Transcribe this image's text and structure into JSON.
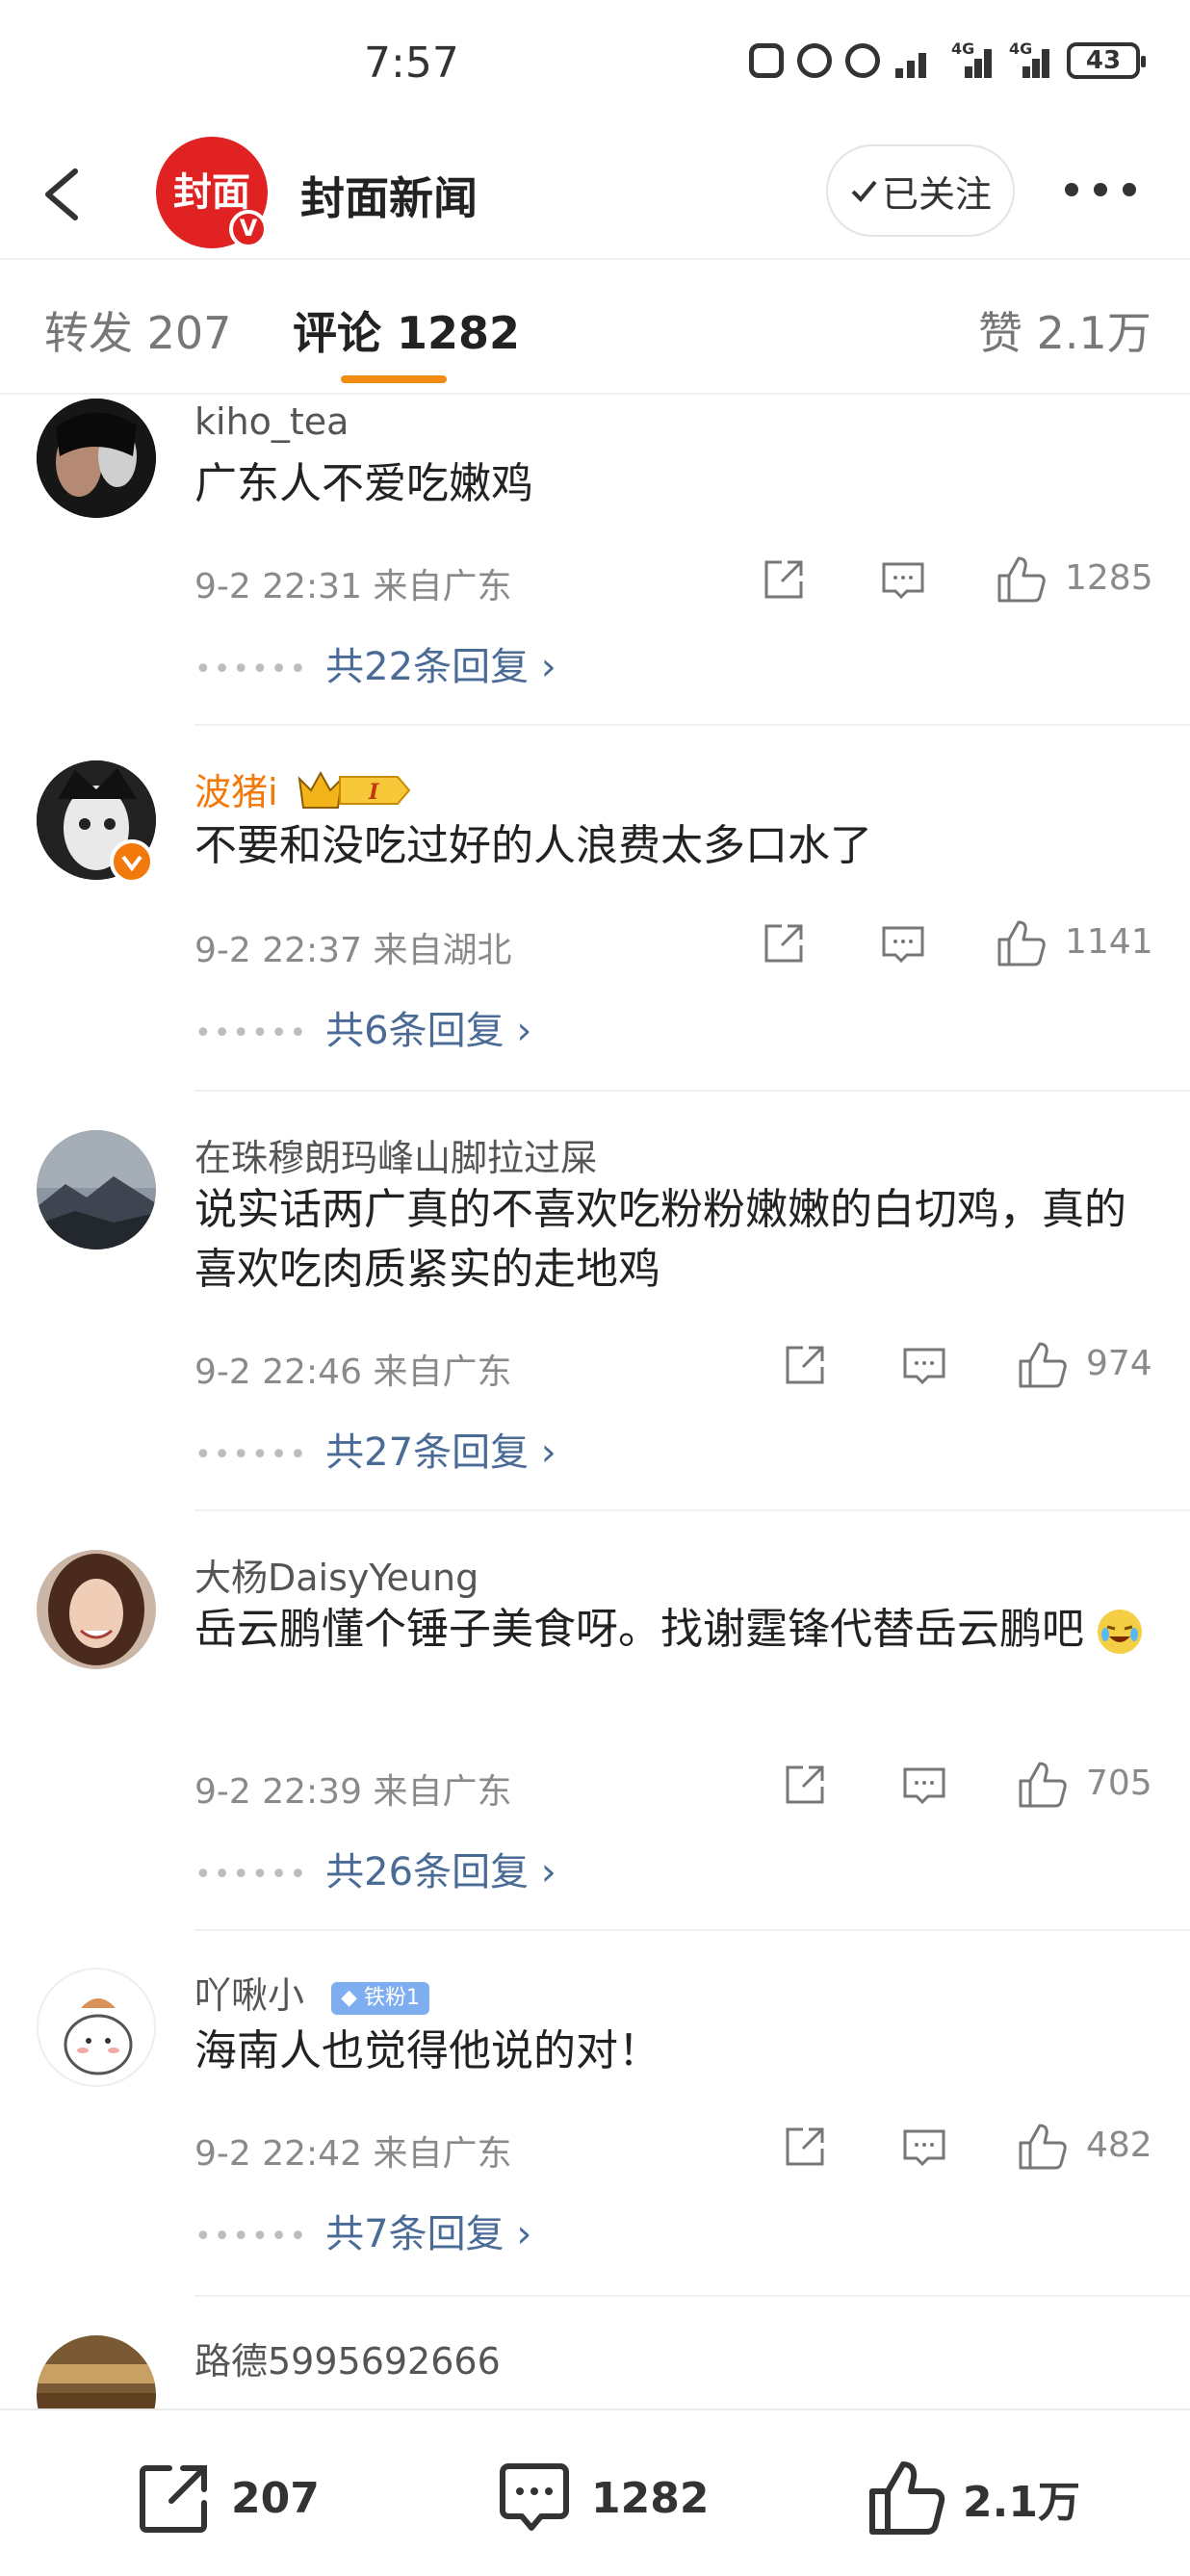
{
  "status_bar": {
    "time": "7:57",
    "battery": "43",
    "network_labels": [
      "4G",
      "4G"
    ]
  },
  "header": {
    "account_name": "封面新闻",
    "logo_text": "封面",
    "verified_badge": "V",
    "follow_label": "已关注"
  },
  "tabs": {
    "repost": "转发 207",
    "comments": "评论 1282",
    "likes": "赞 2.1万"
  },
  "comments": [
    {
      "user": "kiho_tea",
      "text": "广东人不爱吃嫩鸡",
      "time": "9-2 22:31",
      "location": "来自广东",
      "likes": "1285",
      "replies": "共22条回复"
    },
    {
      "user": "波猪i",
      "level_badge": "I",
      "text": "不要和没吃过好的人浪费太多口水了",
      "time": "9-2 22:37",
      "location": "来自湖北",
      "likes": "1141",
      "replies": "共6条回复"
    },
    {
      "user": "在珠穆朗玛峰山脚拉过屎",
      "text": "说实话两广真的不喜欢吃粉粉嫩嫩的白切鸡，真的喜欢吃肉质紧实的走地鸡",
      "time": "9-2 22:46",
      "location": "来自广东",
      "likes": "974",
      "replies": "共27条回复"
    },
    {
      "user": "大杨DaisyYeung",
      "text": "岳云鹏懂个锤子美食呀。找谢霆锋代替岳云鹏吧",
      "time": "9-2 22:39",
      "location": "来自广东",
      "likes": "705",
      "replies": "共26条回复"
    },
    {
      "user": "吖啾小",
      "fan_badge": "铁粉1",
      "text": "海南人也觉得他说的对！",
      "time": "9-2 22:42",
      "location": "来自广东",
      "likes": "482",
      "replies": "共7条回复"
    },
    {
      "user": "路德5995692666"
    }
  ],
  "bottom_bar": {
    "repost_count": "207",
    "comment_count": "1282",
    "like_count": "2.1万"
  }
}
